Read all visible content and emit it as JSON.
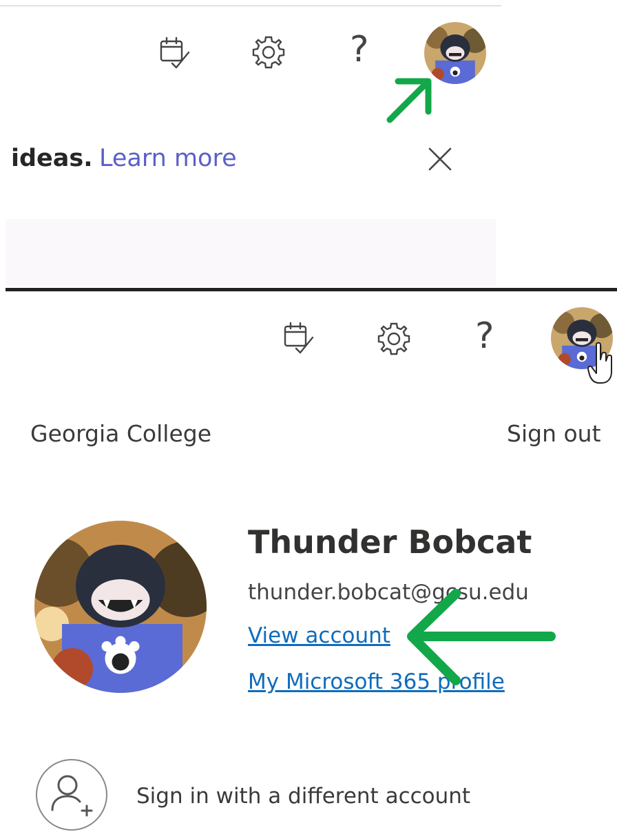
{
  "colors": {
    "link_accent": "#5b5fc7",
    "account_link": "#0f6cbd",
    "annotation_arrow": "#12a84a",
    "avatar_shirt": "#5a6bd6"
  },
  "icons": {
    "calendar_check": "calendar-check-icon",
    "settings": "gear-icon",
    "help": "help-question-icon",
    "close": "close-icon",
    "add_person": "add-person-icon"
  },
  "top": {
    "toolbar": {
      "help_glyph": "?"
    },
    "banner": {
      "text_bold": "ideas.",
      "link_text": "Learn more"
    }
  },
  "bottom": {
    "toolbar": {
      "help_glyph": "?"
    },
    "account_panel": {
      "org_name": "Georgia College",
      "sign_out_label": "Sign out",
      "user_name": "Thunder Bobcat",
      "email": "thunder.bobcat@gcsu.edu",
      "view_account_label": "View account",
      "ms365_profile_label": "My Microsoft 365 profile",
      "sign_in_other_label": "Sign in with a different account"
    }
  }
}
